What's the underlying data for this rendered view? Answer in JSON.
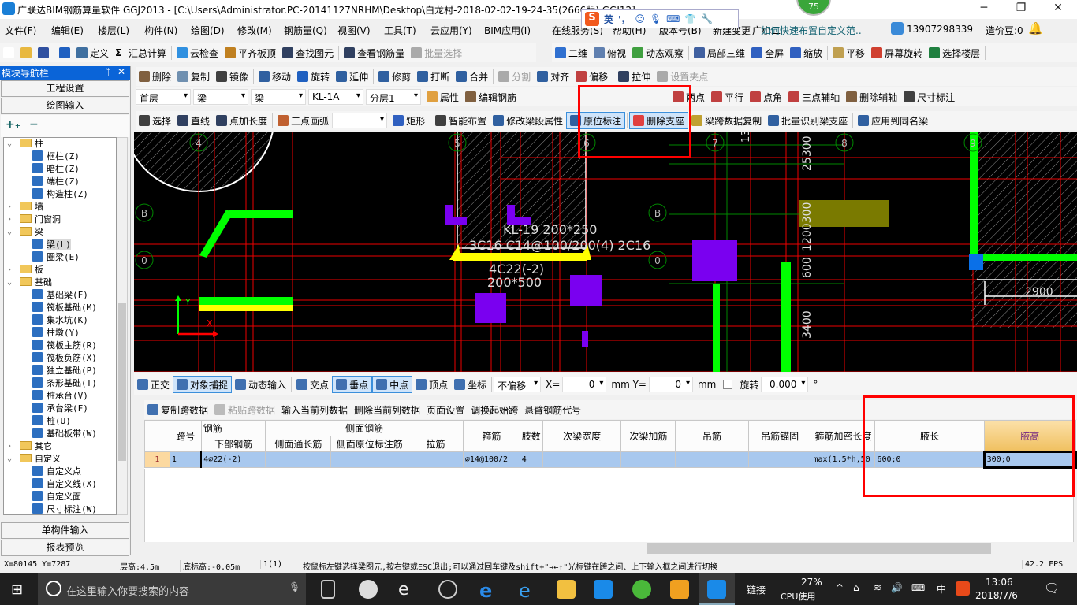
{
  "window": {
    "title": "广联达BIM钢筋算量软件 GGJ2013 - [C:\\Users\\Administrator.PC-20141127NRHM\\Desktop\\白龙村-2018-02-02-19-24-35(2666版).GGJ12]",
    "badge": "75",
    "minimize": "─",
    "restore": "❐",
    "close": "✕"
  },
  "menu": [
    "文件(F)",
    "编辑(E)",
    "楼层(L)",
    "构件(N)",
    "绘图(D)",
    "修改(M)",
    "钢筋量(Q)",
    "视图(V)",
    "工具(T)",
    "云应用(Y)",
    "BIM应用(I)",
    "在线服务(S)",
    "帮助(H)",
    "版本号(B)",
    "新建变更",
    "广小二"
  ],
  "ime": {
    "logo": "S",
    "lang": "英",
    "punct": "'，"
  },
  "help_link": "如何快速布置自定义范..",
  "account": {
    "phone": "13907298339",
    "beans": "造价豆:0"
  },
  "toolbar1": [
    {
      "l": "",
      "c": "#fff"
    },
    {
      "l": "",
      "c": "#e8b840"
    },
    {
      "l": "",
      "c": "#3050a0"
    },
    {
      "l": "",
      "c": "#2060c0"
    },
    {
      "l": "定义",
      "c": "#4070a0"
    },
    {
      "l": "汇总计算",
      "c": "#000",
      "g": "Σ"
    },
    {
      "l": "云检查",
      "c": "#3090e0"
    },
    {
      "l": "平齐板顶",
      "c": "#c08020"
    },
    {
      "l": "查找图元",
      "c": "#304060"
    },
    {
      "l": "查看钢筋量",
      "c": "#304060"
    },
    {
      "l": "批量选择",
      "c": "#aaa",
      "dis": true
    }
  ],
  "toolbar1b": [
    {
      "l": "二维",
      "c": "#3070d0"
    },
    {
      "l": "俯视",
      "c": "#6080b0"
    },
    {
      "l": "动态观察",
      "c": "#40a040"
    },
    {
      "l": "局部三维",
      "c": "#4060a0"
    },
    {
      "l": "全屏",
      "c": "#3060c0"
    },
    {
      "l": "缩放",
      "c": "#3060c0"
    },
    {
      "l": "平移",
      "c": "#c0a050"
    },
    {
      "l": "屏幕旋转",
      "c": "#d04030"
    },
    {
      "l": "选择楼层",
      "c": "#208040"
    }
  ],
  "nav": {
    "title": "模块导航栏",
    "pin": "ᛘ",
    "close": "✕",
    "btn_project": "工程设置",
    "btn_draw": "绘图输入",
    "btn_single": "单构件输入",
    "btn_report": "报表预览",
    "expand_all": "+₊",
    "collapse_all": "−"
  },
  "tree": [
    {
      "l": "柱",
      "lv": 0,
      "open": true
    },
    {
      "l": "框柱(Z)",
      "lv": 1
    },
    {
      "l": "暗柱(Z)",
      "lv": 1
    },
    {
      "l": "端柱(Z)",
      "lv": 1
    },
    {
      "l": "构造柱(Z)",
      "lv": 1
    },
    {
      "l": "墙",
      "lv": 0
    },
    {
      "l": "门窗洞",
      "lv": 0
    },
    {
      "l": "梁",
      "lv": 0,
      "open": true
    },
    {
      "l": "梁(L)",
      "lv": 1,
      "sel": true
    },
    {
      "l": "圈梁(E)",
      "lv": 1
    },
    {
      "l": "板",
      "lv": 0
    },
    {
      "l": "基础",
      "lv": 0,
      "open": true
    },
    {
      "l": "基础梁(F)",
      "lv": 1
    },
    {
      "l": "筏板基础(M)",
      "lv": 1
    },
    {
      "l": "集水坑(K)",
      "lv": 1
    },
    {
      "l": "柱墩(Y)",
      "lv": 1
    },
    {
      "l": "筏板主筋(R)",
      "lv": 1
    },
    {
      "l": "筏板负筋(X)",
      "lv": 1
    },
    {
      "l": "独立基础(P)",
      "lv": 1
    },
    {
      "l": "条形基础(T)",
      "lv": 1
    },
    {
      "l": "桩承台(V)",
      "lv": 1
    },
    {
      "l": "承台梁(F)",
      "lv": 1
    },
    {
      "l": "桩(U)",
      "lv": 1
    },
    {
      "l": "基础板带(W)",
      "lv": 1
    },
    {
      "l": "其它",
      "lv": 0
    },
    {
      "l": "自定义",
      "lv": 0,
      "open": true
    },
    {
      "l": "自定义点",
      "lv": 1
    },
    {
      "l": "自定义线(X)",
      "lv": 1
    },
    {
      "l": "自定义面",
      "lv": 1
    },
    {
      "l": "尺寸标注(W)",
      "lv": 1
    }
  ],
  "toolbar2": [
    {
      "l": "删除",
      "c": "#806040"
    },
    {
      "l": "复制",
      "c": "#7090b0"
    },
    {
      "l": "镜像",
      "c": "#404040"
    },
    {
      "l": "移动",
      "c": "#3060a0"
    },
    {
      "l": "旋转",
      "c": "#2060c0"
    },
    {
      "l": "延伸",
      "c": "#3060a0"
    },
    {
      "l": "修剪",
      "c": "#3060a0"
    },
    {
      "l": "打断",
      "c": "#3060a0"
    },
    {
      "l": "合并",
      "c": "#3060a0"
    },
    {
      "l": "分割",
      "c": "#aaa",
      "dis": true
    },
    {
      "l": "对齐",
      "c": "#3060a0"
    },
    {
      "l": "偏移",
      "c": "#c04040"
    },
    {
      "l": "拉伸",
      "c": "#304060"
    },
    {
      "l": "设置夹点",
      "c": "#aaa",
      "dis": true
    }
  ],
  "toolbar3": {
    "combos": [
      "首层",
      "梁",
      "梁",
      "KL-1A",
      "分层1"
    ],
    "items": [
      {
        "l": "属性",
        "c": "#e0a040"
      },
      {
        "l": "编辑钢筋",
        "c": "#806040"
      }
    ],
    "right": [
      {
        "l": "两点",
        "c": "#c04040"
      },
      {
        "l": "平行",
        "c": "#c04040"
      },
      {
        "l": "点角",
        "c": "#c04040"
      },
      {
        "l": "三点辅轴",
        "c": "#c04040"
      },
      {
        "l": "删除辅轴",
        "c": "#806040"
      },
      {
        "l": "尺寸标注",
        "c": "#404040"
      }
    ]
  },
  "toolbar4": [
    {
      "l": "选择",
      "c": "#404040"
    },
    {
      "l": "直线",
      "c": "#304060"
    },
    {
      "l": "点加长度",
      "c": "#304060"
    },
    {
      "l": "三点画弧",
      "c": "#c06030"
    },
    {
      "l": "",
      "combo": true
    },
    {
      "l": "矩形",
      "c": "#3060c0"
    },
    {
      "l": "智能布置",
      "c": "#404040"
    },
    {
      "l": "修改梁段属性",
      "c": "#3060a0"
    },
    {
      "l": "原位标注",
      "c": "#3060a0",
      "pressed": true
    },
    {
      "l": "删除支座",
      "c": "#e04040",
      "pressed": true
    },
    {
      "l": "梁跨数据复制",
      "c": "#c0a030"
    },
    {
      "l": "批量识别梁支座",
      "c": "#3060a0"
    },
    {
      "l": "应用到同名梁",
      "c": "#3060a0"
    }
  ],
  "canvas": {
    "axes": {
      "a4": "4",
      "a5": "5",
      "a6": "6",
      "a7": "7",
      "a8": "8",
      "a9": "9",
      "b_left": "B",
      "b_mid": "B",
      "o_left": "0",
      "o_mid": "0"
    },
    "beam_label1": "KL-19  200*250",
    "beam_label2": "3C16 C14@100/200(4)  2C16",
    "beam_label3": "4C22(-2)",
    "beam_label4": "200*500",
    "dims": {
      "d1": "2900",
      "d2": "3400",
      "d3": "600",
      "d4": "1200300",
      "d5": "25300 2",
      "d6": "13"
    },
    "ucs_x": "X",
    "ucs_y": "Y"
  },
  "snapbar": {
    "items": [
      {
        "l": "正交"
      },
      {
        "l": "对象捕捉",
        "pressed": true
      },
      {
        "l": "动态输入"
      },
      {
        "l": "交点"
      },
      {
        "l": "垂点",
        "pressed": true
      },
      {
        "l": "中点",
        "pressed": true
      },
      {
        "l": "顶点"
      },
      {
        "l": "坐标"
      }
    ],
    "offset": "不偏移",
    "x_label": "X=",
    "x_value": "0",
    "y_label": "mm Y=",
    "y_value": "0",
    "unit": "mm",
    "rotate_label": "旋转",
    "rotate_value": "0.000",
    "deg": "°"
  },
  "gridbar": [
    {
      "l": "复制跨数据"
    },
    {
      "l": "粘贴跨数据",
      "dis": true
    },
    {
      "l": "输入当前列数据"
    },
    {
      "l": "删除当前列数据"
    },
    {
      "l": "页面设置"
    },
    {
      "l": "调换起始跨"
    },
    {
      "l": "悬臂钢筋代号"
    }
  ],
  "table": {
    "h_span": "跨号",
    "h_rebar": "钢筋",
    "h_bottom": "下部钢筋",
    "h_side": "侧面钢筋",
    "h_side_long": "侧面通长筋",
    "h_side_orig": "侧面原位标注筋",
    "h_tie": "拉筋",
    "h_stirrup": "箍筋",
    "h_legs": "肢数",
    "h_sec_width": "次梁宽度",
    "h_sec_add": "次梁加筋",
    "h_hanger": "吊筋",
    "h_hanger_anchor": "吊筋锚固",
    "h_dense": "箍筋加密长度",
    "h_haunch_len": "腋长",
    "h_haunch_h": "腋高",
    "rows": [
      {
        "rn": "1",
        "span": "1",
        "bottom": "4⌀22(-2)",
        "side_long": "",
        "side_orig": "",
        "tie": "",
        "stirrup": "⌀14@100/2",
        "legs": "4",
        "sec_width": "",
        "sec_add": "",
        "hanger": "",
        "hanger_anchor": "",
        "dense": "max(1.5*h,50",
        "haunch_len": "600;0",
        "haunch_h": "300;0"
      }
    ]
  },
  "status": {
    "coords": "X=80145 Y=7287",
    "floor_h": "层高:4.5m",
    "base_h": "底标高:-0.05m",
    "count": "1(1)",
    "hint": "按鼠标左键选择梁图元,按右键或ESC退出;可以通过回车键及shift+\"→←↑\"光标键在跨之间、上下输入框之间进行切换",
    "fps": "42.2 FPS"
  },
  "taskbar": {
    "search": "在这里输入你要搜索的内容",
    "link": "链接",
    "cpu_pct": "27%",
    "cpu_label": "CPU使用",
    "ime": "中",
    "time": "13:06",
    "date": "2018/7/6"
  },
  "colors": {
    "accent": "#0a64d8",
    "annotation_red": "#ff0000",
    "canvas_bg": "#000000"
  }
}
